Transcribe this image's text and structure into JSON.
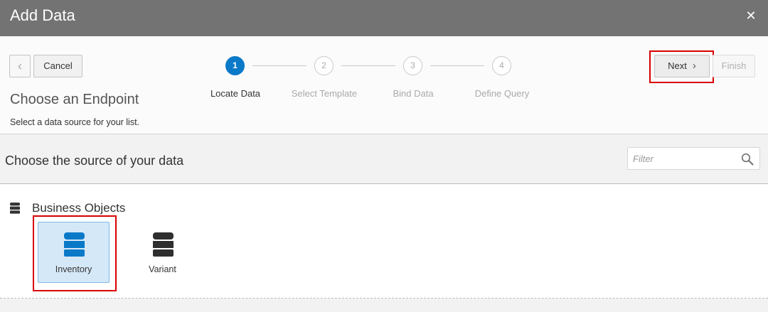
{
  "dialog": {
    "title": "Add Data",
    "close_glyph": "✕"
  },
  "toolbar": {
    "back_glyph": "‹",
    "cancel_label": "Cancel",
    "next_label": "Next",
    "next_glyph": "›",
    "finish_label": "Finish"
  },
  "train": {
    "steps": [
      {
        "number": "1",
        "label": "Locate Data",
        "state": "active"
      },
      {
        "number": "2",
        "label": "Select Template",
        "state": "inactive"
      },
      {
        "number": "3",
        "label": "Bind Data",
        "state": "inactive"
      },
      {
        "number": "4",
        "label": "Define Query",
        "state": "inactive"
      }
    ]
  },
  "step": {
    "title": "Choose an Endpoint",
    "description": "Select a data source for your list."
  },
  "source": {
    "title": "Choose the source of your data",
    "filter_placeholder": "Filter",
    "filter_value": ""
  },
  "category": {
    "title": "Business Objects",
    "items": [
      {
        "label": "Inventory",
        "selected": true,
        "icon": "database-icon",
        "color": "#0a79c8"
      },
      {
        "label": "Variant",
        "selected": false,
        "icon": "database-icon",
        "color": "#2f2f2f"
      }
    ]
  },
  "colors": {
    "titlebar": "#737373",
    "accent": "#0a79c8",
    "highlight": "#d80000",
    "selected_tile": "#d5e8f8"
  }
}
